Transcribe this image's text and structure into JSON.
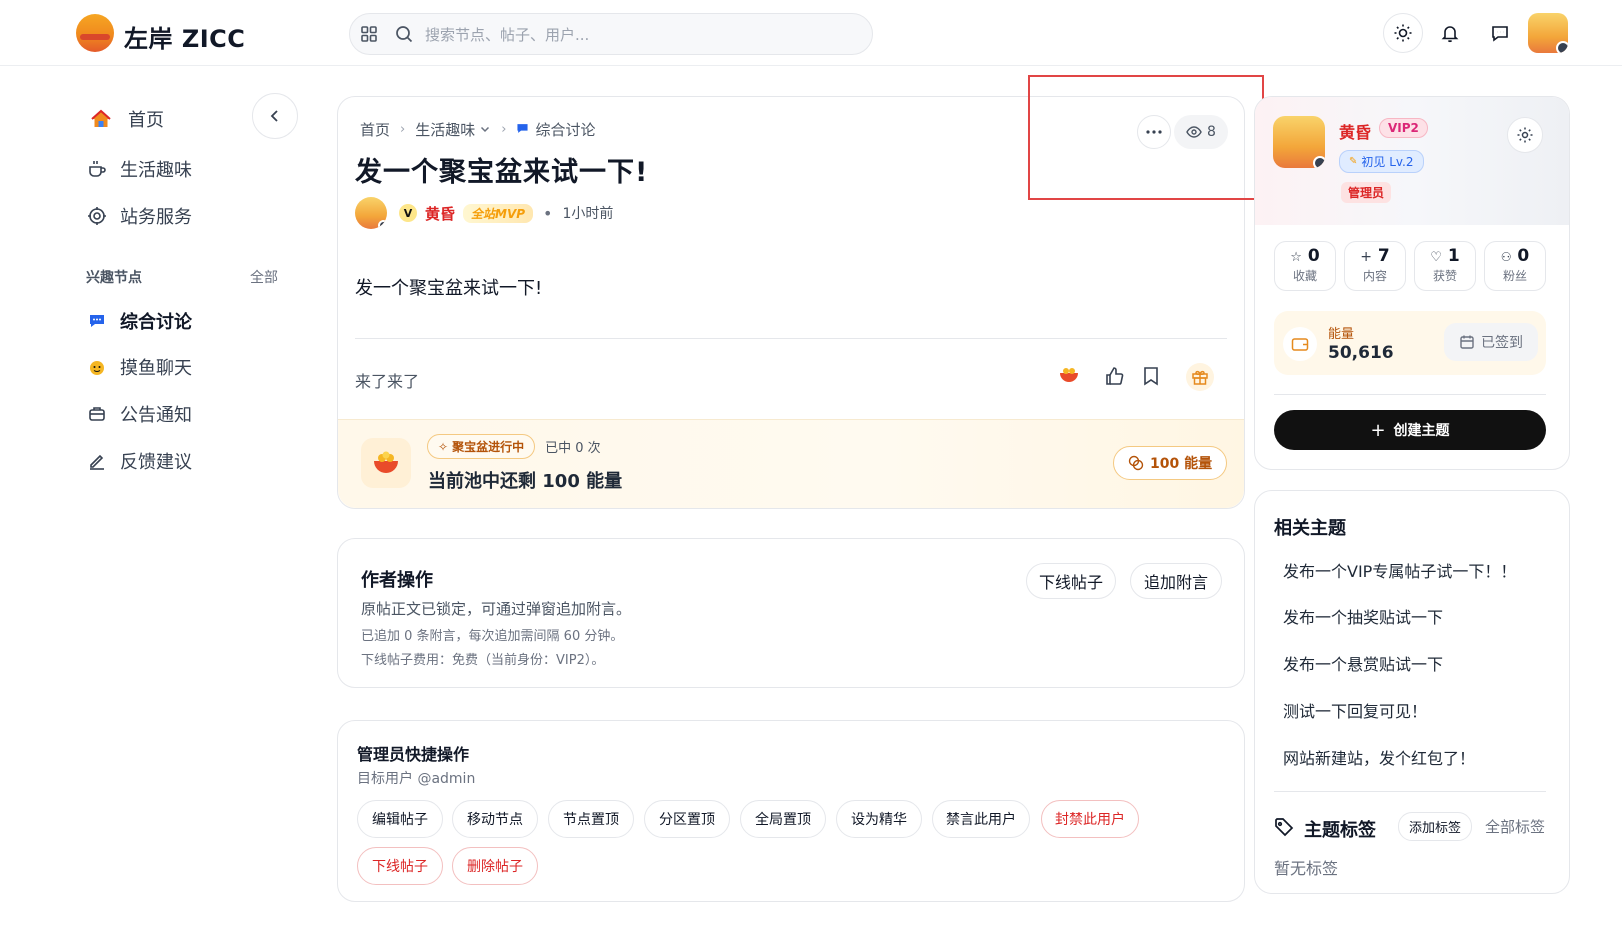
{
  "header": {
    "brand": "左岸 ZICC",
    "search_placeholder": "搜索节点、帖子、用户..."
  },
  "sidebar": {
    "items": [
      {
        "label": "首页",
        "icon": "home-icon"
      },
      {
        "label": "生活趣味",
        "icon": "coffee-icon"
      },
      {
        "label": "站务服务",
        "icon": "service-icon"
      }
    ],
    "section_title": "兴趣节点",
    "section_all": "全部",
    "nodes": [
      {
        "label": "综合讨论",
        "icon": "chat-bubble-icon"
      },
      {
        "label": "摸鱼聊天",
        "icon": "fish-icon"
      },
      {
        "label": "公告通知",
        "icon": "notice-icon"
      },
      {
        "label": "反馈建议",
        "icon": "pen-icon"
      }
    ]
  },
  "post": {
    "breadcrumb": [
      "首页",
      "生活趣味",
      "综合讨论"
    ],
    "views": "8",
    "title": "发一个聚宝盆来试一下!",
    "author": "黄昏",
    "author_badge": "全站MVP",
    "time": "1小时前",
    "body": "发一个聚宝盆来试一下!",
    "appendix": "来了来了"
  },
  "pool": {
    "status_tag": "聚宝盆进行中",
    "hit_count": "已中 0 次",
    "remaining": "当前池中还剩 100 能量",
    "energy_button": "100 能量"
  },
  "author_ops": {
    "title": "作者操作",
    "desc1": "原帖正文已锁定，可通过弹窗追加附言。",
    "desc2": "已追加 0 条附言，每次追加需间隔 60 分钟。",
    "desc3": "下线帖子费用：免费（当前身份：VIP2）。",
    "btn_offline": "下线帖子",
    "btn_append": "追加附言"
  },
  "admin_ops": {
    "title": "管理员快捷操作",
    "target": "目标用户 @admin",
    "buttons": [
      "编辑帖子",
      "移动节点",
      "节点置顶",
      "分区置顶",
      "全局置顶",
      "设为精华",
      "禁言此用户",
      "封禁此用户",
      "下线帖子",
      "删除帖子"
    ]
  },
  "profile": {
    "name": "黄昏",
    "vip": "VIP2",
    "level": "初见 Lv.2",
    "role": "管理员",
    "stats": [
      {
        "num": "0",
        "label": "收藏",
        "icon": "star-icon"
      },
      {
        "num": "7",
        "label": "内容",
        "icon": "plus-icon"
      },
      {
        "num": "1",
        "label": "获赞",
        "icon": "heart-icon"
      },
      {
        "num": "0",
        "label": "粉丝",
        "icon": "users-icon"
      }
    ],
    "energy_label": "能量",
    "energy_value": "50,616",
    "checked_in": "已签到",
    "create_topic": "创建主题"
  },
  "related": {
    "title": "相关主题",
    "items": [
      "发布一个VIP专属帖子试一下！！",
      "发布一个抽奖贴试一下",
      "发布一个悬赏贴试一下",
      "测试一下回复可见！",
      "网站新建站，发个红包了！"
    ]
  },
  "tags": {
    "title": "主题标签",
    "add": "添加标签",
    "all": "全部标签",
    "empty": "暂无标签"
  },
  "colors": {
    "accent_red": "#dc2626",
    "energy_bg": "#fff8ea",
    "primary_dark": "#111827"
  }
}
